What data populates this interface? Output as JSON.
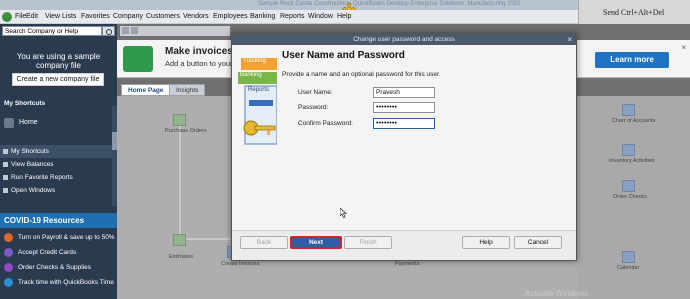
{
  "window": {
    "title": "Sample Rock Castle Construction - QuickBooks Desktop Enterprise Solutions: Manufacturing 2022"
  },
  "vm_bar": {
    "send_cad": "Send Ctrl+Alt+Del"
  },
  "menubar": {
    "items": [
      "File",
      "Edit",
      "View",
      "Lists",
      "Favorites",
      "Company",
      "Customers",
      "Vendors",
      "Employees",
      "Banking",
      "Reports",
      "Window",
      "Help"
    ]
  },
  "leftnav": {
    "search_placeholder": "Search Company or Help",
    "sample_text_1": "You are using a sample",
    "sample_text_2": "company file",
    "create_button": "Create a new company file",
    "my_shortcuts_heading": "My Shortcuts",
    "home": "Home",
    "items": [
      "My Shortcuts",
      "View Balances",
      "Run Favorite Reports",
      "Open Windows"
    ],
    "covid_heading": "COVID-19 Resources",
    "covid_items": [
      "Turn on Payroll & save up to 50%",
      "Accept Credit Cards",
      "Order Checks & Supplies",
      "Track time with QuickBooks Time"
    ]
  },
  "banner": {
    "title": "Make invoices",
    "subtitle": "Add a button to your",
    "learn_more": "Learn more",
    "close": "×"
  },
  "page_tabs": [
    "Home Page",
    "Insights"
  ],
  "dialog": {
    "title": "Change user password and access",
    "close": "×",
    "art_labels": [
      "Tracking",
      "Banking",
      "Reports"
    ],
    "heading": "User Name and Password",
    "description": "Provide a name and an optional password for this user.",
    "fields": {
      "user_name_label": "User Name:",
      "user_name_value": "Pravesh",
      "password_label": "Password:",
      "password_value": "••••••••",
      "confirm_label": "Confirm Password:",
      "confirm_value": "••••••••"
    },
    "buttons": {
      "back": "Back",
      "next": "Next",
      "finish": "Finish",
      "help": "Help",
      "cancel": "Cancel"
    }
  },
  "workflow_labels": [
    "Purchase Orders",
    "Estimates",
    "Create Invoices",
    "Payments",
    "Chart of Accounts",
    "Inventory Activities",
    "Order Checks",
    "Calendar"
  ],
  "watermark": "Activate Windows",
  "colors": {
    "nav_bg": "#2a3b4f",
    "covid_header": "#1f6fb3",
    "primary_button": "#2a5ea7",
    "highlight_border": "#d8202b"
  }
}
